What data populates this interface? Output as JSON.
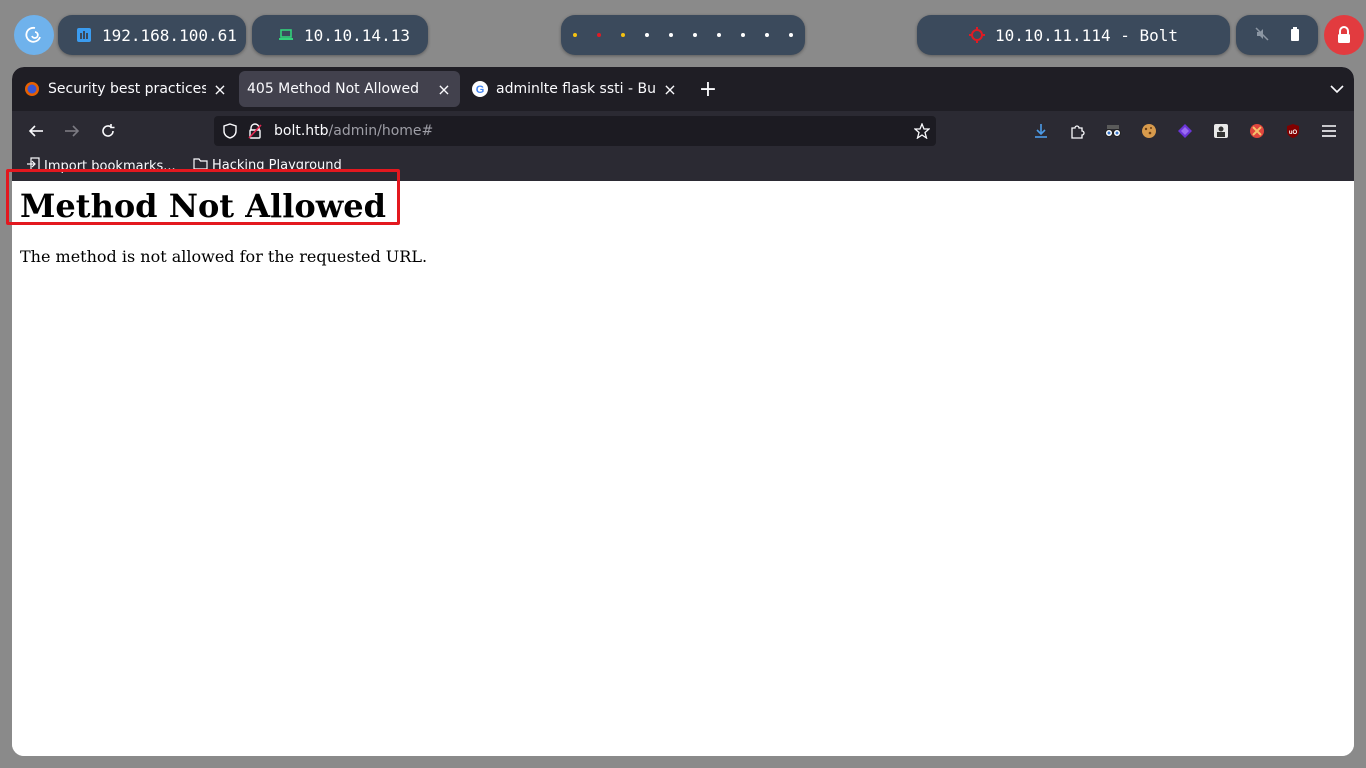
{
  "panel": {
    "local_ip": "192.168.100.61",
    "vpn_ip": "10.10.14.13",
    "target": "10.10.11.114 - Bolt",
    "workspace_dot_colors": [
      "#f5c211",
      "#e01b24",
      "#f5c211",
      "#ffffff",
      "#ffffff",
      "#ffffff",
      "#ffffff",
      "#ffffff",
      "#ffffff",
      "#ffffff"
    ]
  },
  "browser": {
    "tabs": [
      {
        "title": "Security best practices |",
        "favicon": "firefox-icon",
        "active": false
      },
      {
        "title": "405 Method Not Allowed",
        "favicon": "",
        "active": true
      },
      {
        "title": "adminlte flask ssti - Busc",
        "favicon": "google-icon",
        "active": false
      }
    ],
    "url_host": "bolt.htb",
    "url_path": "/admin/home#",
    "bookmarks": [
      {
        "label": "Import bookmarks...",
        "icon": "import-icon"
      },
      {
        "label": "Hacking Playground",
        "icon": "folder-icon"
      }
    ]
  },
  "page": {
    "heading": "Method Not Allowed",
    "message": "The method is not allowed for the requested URL."
  },
  "colors": {
    "highlight": "#e3181f",
    "panel_bg": "#3b4a5c",
    "lock": "#e23b3f"
  }
}
